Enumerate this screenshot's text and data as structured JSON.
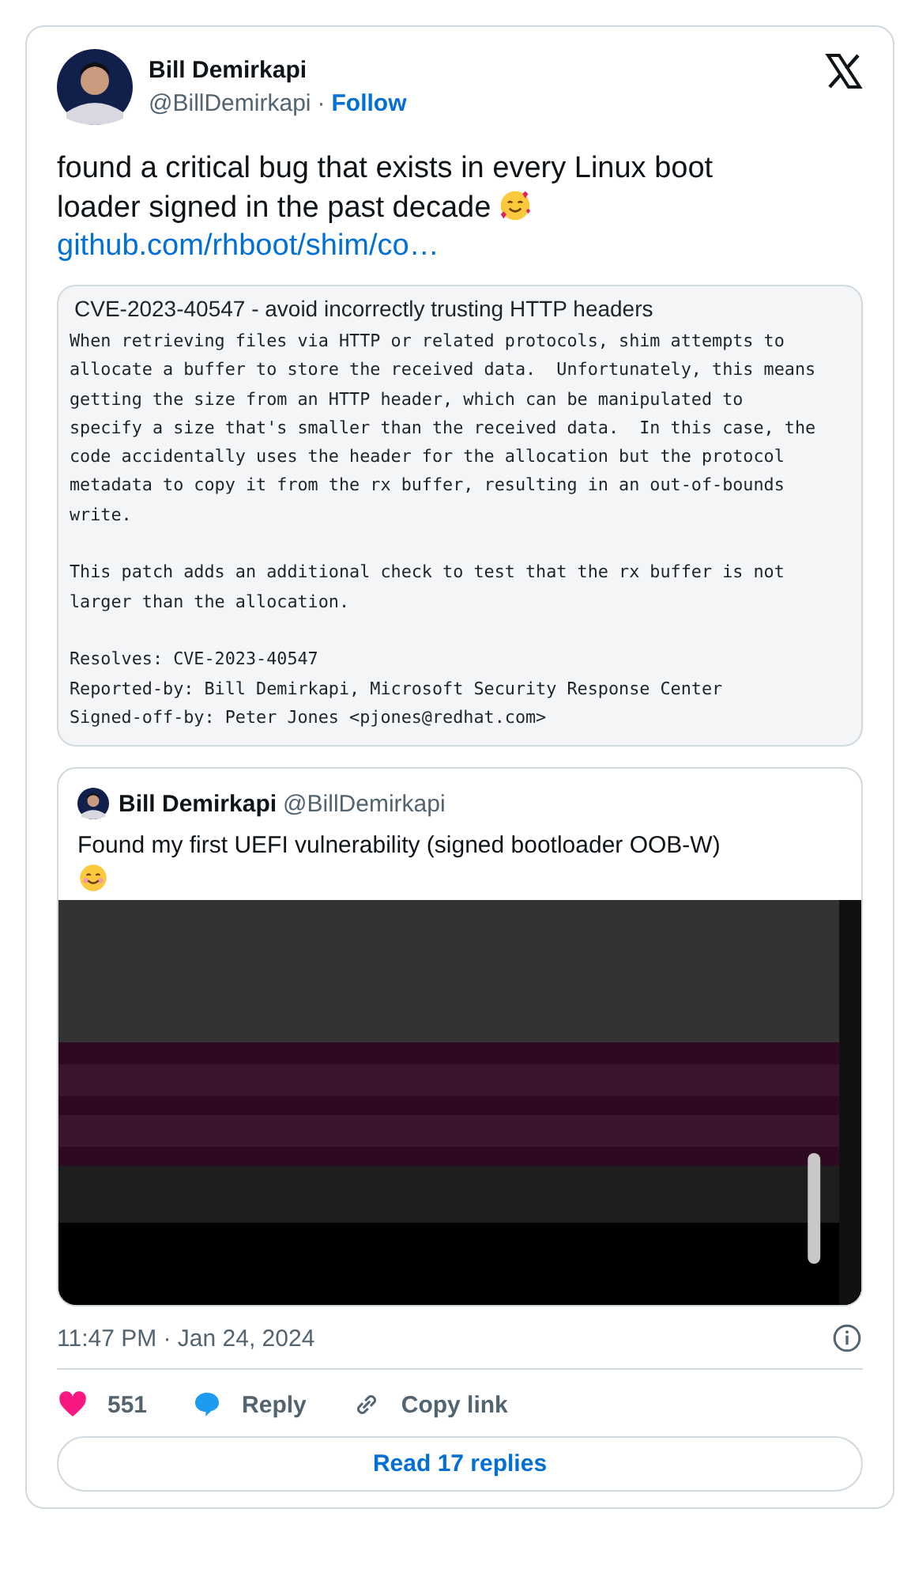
{
  "author": {
    "name": "Bill Demirkapi",
    "handle": "@BillDemirkapi",
    "separator": "·",
    "follow": "Follow"
  },
  "text_lines": [
    "found a critical bug that exists in every Linux boot",
    "loader signed in the past decade"
  ],
  "link": "github.com/rhboot/shim/co…",
  "link_card": {
    "title": "CVE-2023-40547 - avoid incorrectly trusting HTTP headers",
    "paragraphs": [
      [
        "When retrieving files via HTTP or related protocols, shim attempts to",
        "allocate a buffer to store the received data.  Unfortunately, this means",
        "getting the size from an HTTP header, which can be manipulated to",
        "specify a size that's smaller than the received data.  In this case, the",
        "code accidentally uses the header for the allocation but the protocol",
        "metadata to copy it from the rx buffer, resulting in an out-of-bounds",
        "write."
      ],
      [
        "This patch adds an additional check to test that the rx buffer is not",
        "larger than the allocation."
      ],
      [
        "Resolves: CVE-2023-40547",
        "Reported-by: Bill Demirkapi, Microsoft Security Response Center",
        "Signed-off-by: Peter Jones <pjones@redhat.com>"
      ]
    ]
  },
  "quote": {
    "name": "Bill Demirkapi",
    "handle": "@BillDemirkapi",
    "text": "Found my first UEFI vulnerability (signed bootloader OOB-W)"
  },
  "timestamp": "11:47 PM · Jan 24, 2024",
  "actions": [
    {
      "kind": "like",
      "label": "551"
    },
    {
      "kind": "reply",
      "label": "Reply"
    },
    {
      "kind": "copy",
      "label": "Copy link"
    }
  ],
  "read_replies": "Read 17 replies"
}
